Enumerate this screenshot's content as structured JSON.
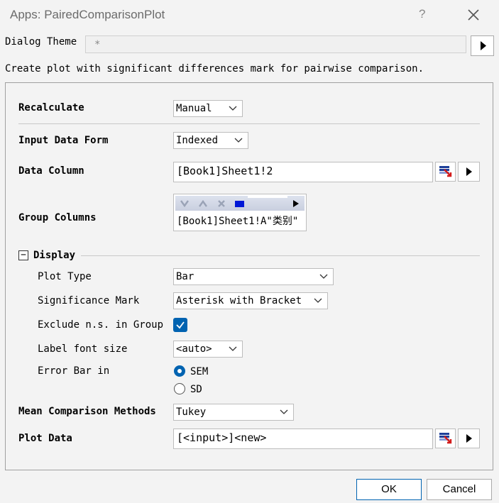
{
  "window": {
    "title": "Apps: PairedComparisonPlot",
    "help_glyph": "?",
    "close_icon": "close-icon"
  },
  "theme": {
    "label": "Dialog Theme",
    "value": "*"
  },
  "description": "Create plot with significant differences mark for pairwise comparison.",
  "recalculate": {
    "label": "Recalculate",
    "value": "Manual"
  },
  "input_form": {
    "label": "Input Data Form",
    "value": "Indexed"
  },
  "data_column": {
    "label": "Data Column",
    "value": "[Book1]Sheet1!2"
  },
  "group_columns": {
    "label": "Group Columns",
    "value": "[Book1]Sheet1!A\"类别\""
  },
  "display": {
    "header": "Display",
    "collapse_glyph": "−",
    "plot_type": {
      "label": "Plot Type",
      "value": "Bar"
    },
    "sig_mark": {
      "label": "Significance Mark",
      "value": "Asterisk with Bracket"
    },
    "exclude_ns": {
      "label": "Exclude n.s. in Group",
      "checked": true
    },
    "label_font": {
      "label": "Label font size",
      "value": "<auto>"
    },
    "error_bar": {
      "label": "Error Bar in",
      "options": [
        "SEM",
        "SD"
      ],
      "selected": "SEM"
    }
  },
  "mean_comparison": {
    "label": "Mean Comparison Methods",
    "value": "Tukey"
  },
  "plot_data": {
    "label": "Plot Data",
    "value": "[<input>]<new>"
  },
  "buttons": {
    "ok": "OK",
    "cancel": "Cancel"
  },
  "colors": {
    "accent": "#0063b1",
    "background": "#f3f3f3"
  }
}
